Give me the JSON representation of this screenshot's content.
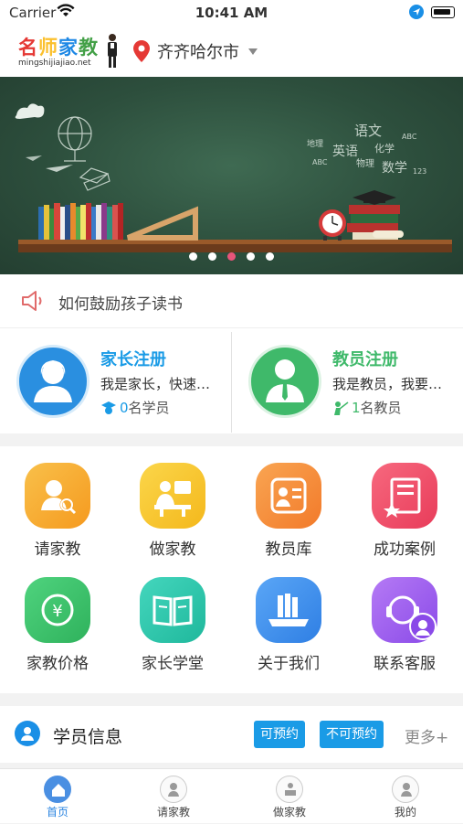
{
  "status_bar": {
    "carrier": "Carrier",
    "time": "10:41 AM"
  },
  "header": {
    "logo_text": "名师家教",
    "logo_domain": "mingshijiajiao.net",
    "city": "齐齐哈尔市"
  },
  "banner": {
    "slide_count": 5,
    "active_index": 2,
    "blackboard_words": [
      "语文",
      "英语",
      "化学",
      "数学",
      "物理",
      "地理"
    ]
  },
  "notice": {
    "text": "如何鼓励孩子读书"
  },
  "register": {
    "parent": {
      "title": "家长注册",
      "desc": "我是家长，快速找老师",
      "count": "0",
      "count_label": "名学员"
    },
    "teacher": {
      "title": "教员注册",
      "desc": "我是教员，我要做家教",
      "count": "1",
      "count_label": "名教员"
    }
  },
  "menu": [
    {
      "label": "请家教",
      "icon": "find-tutor-icon",
      "color": "#f5a623"
    },
    {
      "label": "做家教",
      "icon": "teach-icon",
      "color": "#f7c325"
    },
    {
      "label": "教员库",
      "icon": "teacher-library-icon",
      "color": "#f58a3c"
    },
    {
      "label": "成功案例",
      "icon": "success-case-icon",
      "color": "#f04e6a"
    },
    {
      "label": "家教价格",
      "icon": "price-icon",
      "color": "#3ec46d"
    },
    {
      "label": "家长学堂",
      "icon": "parent-school-icon",
      "color": "#2fc6ad"
    },
    {
      "label": "关于我们",
      "icon": "about-us-icon",
      "color": "#3d8ff0"
    },
    {
      "label": "联系客服",
      "icon": "customer-service-icon",
      "color": "#9b5cf0"
    }
  ],
  "student_info": {
    "title": "学员信息",
    "tag_available": "可预约",
    "tag_unavailable": "不可预约",
    "more": "更多+"
  },
  "tabbar": [
    {
      "label": "首页",
      "active": true
    },
    {
      "label": "请家教",
      "active": false
    },
    {
      "label": "做家教",
      "active": false
    },
    {
      "label": "我的",
      "active": false
    }
  ]
}
